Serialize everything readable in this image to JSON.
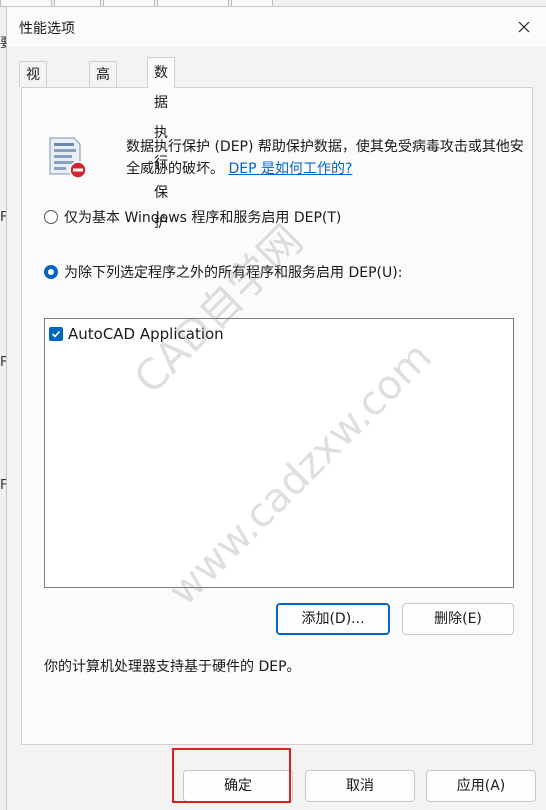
{
  "dialog": {
    "title": "性能选项"
  },
  "tabs": [
    {
      "label": "视觉效果"
    },
    {
      "label": "高级"
    },
    {
      "label": "数据执行保护"
    }
  ],
  "dep": {
    "description": "数据执行保护 (DEP) 帮助保护数据，使其免受病毒攻击或其他安全威胁的破坏。",
    "link": "DEP 是如何工作的?",
    "option1": "仅为基本 Windows 程序和服务启用 DEP(T)",
    "option2": "为除下列选定程序之外的所有程序和服务启用 DEP(U):",
    "selected_option": 2,
    "programs": [
      {
        "name": "AutoCAD Application",
        "checked": true
      }
    ],
    "add_label": "添加(D)...",
    "remove_label": "删除(E)",
    "hardware_note": "你的计算机处理器支持基于硬件的 DEP。"
  },
  "footer": {
    "ok_label": "确定",
    "cancel_label": "取消",
    "apply_label": "应用(A)"
  },
  "watermark": {
    "line1": "CAD自学网",
    "line2": "www.cadzxw.com"
  },
  "background_glyphs": [
    "要",
    "F",
    "F",
    "F"
  ]
}
